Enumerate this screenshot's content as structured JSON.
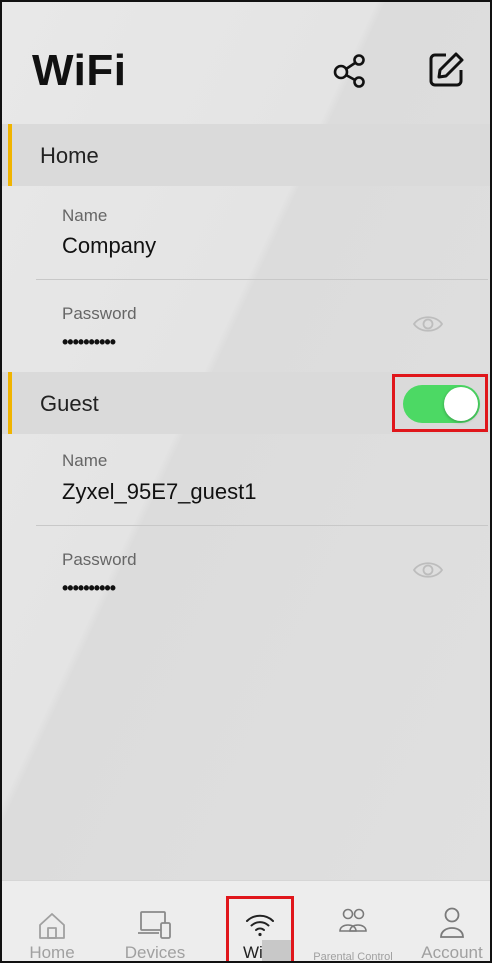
{
  "header": {
    "title": "WiFi",
    "share_icon": "share-icon",
    "edit_icon": "edit-icon"
  },
  "home_section": {
    "title": "Home",
    "name_label": "Name",
    "name_value": "Company",
    "password_label": "Password",
    "password_value": "••••••••••",
    "show_password_icon": "eye-icon"
  },
  "guest_section": {
    "title": "Guest",
    "enabled": true,
    "name_label": "Name",
    "name_value": "Zyxel_95E7_guest1",
    "password_label": "Password",
    "password_value": "••••••••••",
    "show_password_icon": "eye-icon"
  },
  "colors": {
    "accent": "#f0b400",
    "toggle_on": "#4cd964",
    "highlight": "#e0161b"
  },
  "bottom_nav": {
    "items": [
      {
        "label": "Home",
        "icon": "home-icon"
      },
      {
        "label": "Devices",
        "icon": "devices-icon"
      },
      {
        "label": "WiFi",
        "icon": "wifi-icon",
        "active": true
      },
      {
        "label": "Parental Control",
        "icon": "parental-control-icon"
      },
      {
        "label": "Account",
        "icon": "account-icon"
      }
    ]
  }
}
